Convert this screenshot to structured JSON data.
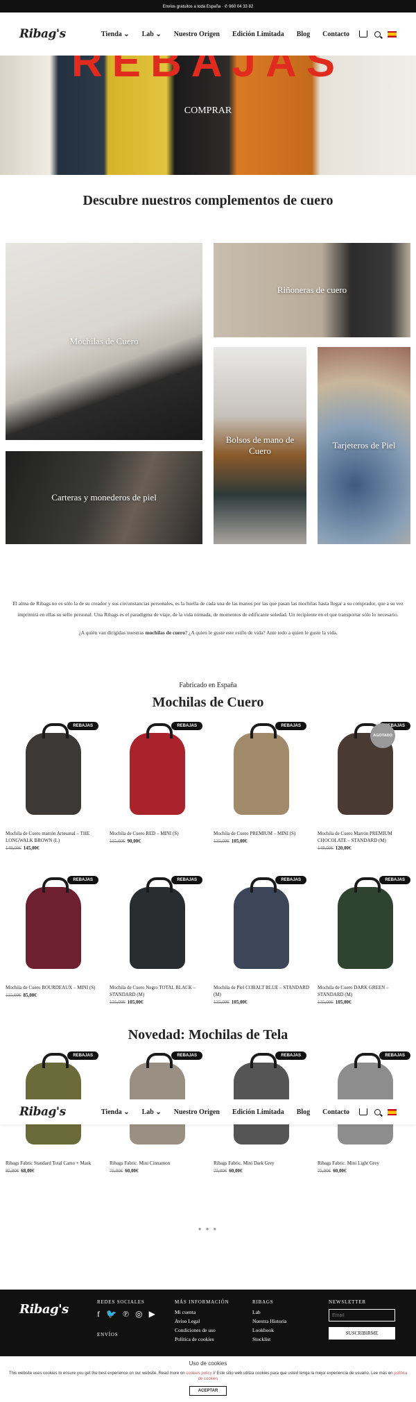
{
  "topbar": {
    "text": "Envíos gratuitos a toda España · ✆ 960 04 33 82"
  },
  "header": {
    "logo": "Ribag's",
    "nav": [
      "Tienda ⌄",
      "Lab ⌄",
      "Nuestro Origen",
      "Edición Limitada",
      "Blog",
      "Contacto"
    ],
    "cart_count": "0"
  },
  "hero": {
    "word": "REBAJAS",
    "cta": "COMPRAR"
  },
  "categories": {
    "title": "Descubre nuestros complementos de cuero",
    "items": [
      "Mochilas de Cuero",
      "Riñoneras de cuero",
      "Bolsos de mano de Cuero",
      "Tarjeteros de Piel",
      "Carteras y monederos de piel"
    ]
  },
  "intro": {
    "p1": "El alma de Ribags no es sólo la de su creador y sus circunstancias personales, es la huella de cada una de las manos por las que pasan las mochilas hasta llegar a su comprador, que a su vez imprimirá en ellas su sello personal. Una Ribags es el paradigma de viaje, de la vida nómada, de momentos de edificante soledad. Un recipiente en el que transportar sólo lo necesario.",
    "p2_a": "¿A quién van dirigidas nuestras ",
    "p2_b": "mochilas de cuero",
    "p2_c": "? ¿A quien le guste este estilo de vida? Ante todo a quien le guste la vida."
  },
  "leather": {
    "kicker": "Fabricado en España",
    "title": "Mochilas de Cuero",
    "badge": "REBAJAS",
    "soldout": "AGOTADO",
    "products": [
      {
        "name": "Mochila de Cuero marrón Artesanal – THE LONGWALK BROWN (L)",
        "old": "149,00€",
        "price": "145,00€",
        "color": "#3b3835"
      },
      {
        "name": "Mochila de Cuero RED – MINI (S)",
        "old": "115,00€",
        "price": "90,00€",
        "color": "#a8232c"
      },
      {
        "name": "Mochila de Cuero PREMIUM – MINI (S)",
        "old": "135,00€",
        "price": "105,00€",
        "color": "#a08a6a"
      },
      {
        "name": "Mochila de Cuero Marrón PREMIUM CHOCOLATE – STANDARD (M)",
        "old": "149,00€",
        "price": "120,00€",
        "color": "#4a3a34"
      },
      {
        "name": "Mochila de Cuero BOURDEAUX – MINI (S)",
        "old": "115,00€",
        "price": "85,00€",
        "color": "#6e2030"
      },
      {
        "name": "Mochila de Cuero Negro TOTAL BLACK – STANDARD (M)",
        "old": "135,00€",
        "price": "105,00€",
        "color": "#2a2d2f"
      },
      {
        "name": "Mochila de Piel COBALT BLUE – STANDARD (M)",
        "old": "135,00€",
        "price": "105,00€",
        "color": "#3c4658"
      },
      {
        "name": "Mochila de Cuero DARK GREEN – STANDARD (M)",
        "old": "135,00€",
        "price": "105,00€",
        "color": "#2e4330"
      }
    ]
  },
  "fabric": {
    "title": "Novedad: Mochilas de Tela",
    "products": [
      {
        "name": "Ribags Fabric Standard Total Camo + Mask",
        "old": "85,00€",
        "price": "68,00€",
        "color": "#6b6a3a"
      },
      {
        "name": "Ribags Fabric. Mini Cinnamon",
        "old": "75,00€",
        "price": "60,00€",
        "color": "#9a8f83"
      },
      {
        "name": "Ribags Fabric. Mini Dark Grey",
        "old": "75,00€",
        "price": "60,00€",
        "color": "#555555"
      },
      {
        "name": "Ribags Fabric. Mini Light Grey",
        "old": "75,00€",
        "price": "60,00€",
        "color": "#8d8d8d"
      }
    ],
    "dots": "● ● ●"
  },
  "footer": {
    "logo": "Ribag's",
    "social_title": "REDES SOCIALES",
    "shipping_title": "ENVÍOS",
    "info_title": "MÁS INFORMACIÓN",
    "info_links": [
      "Mi cuenta",
      "Aviso Legal",
      "Condiciones de uso",
      "Política de cookies"
    ],
    "brand_title": "RIBAGS",
    "brand_links": [
      "Lab",
      "Nuestra Historia",
      "Lookbook",
      "Stocklist"
    ],
    "newsletter_title": "NEWSLETTER",
    "email_placeholder": "Email",
    "subscribe": "SUSCRIBIRME"
  },
  "cookie": {
    "title": "Uso de cookies",
    "text_a": "This website uses cookies to ensure you get the best experience on our website. Read more on ",
    "link": "cookies policy",
    "text_b": " // Este sitio web utiliza cookies para que usted tenga la mejor experiencia de usuario. Lee más en ",
    "link2": "política de cookies",
    "accept": "ACEPTAR"
  }
}
